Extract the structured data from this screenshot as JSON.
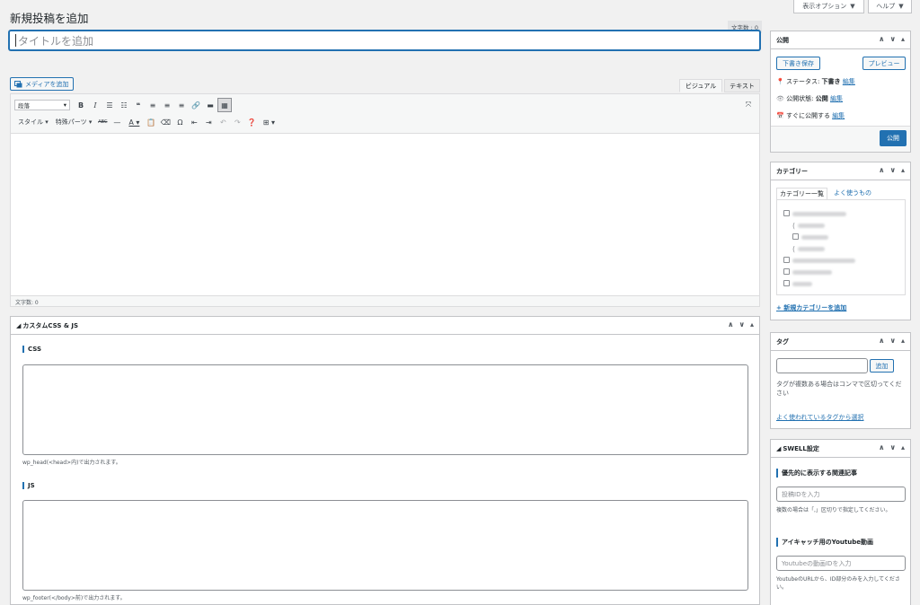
{
  "screen_options": {
    "display_options": "表示オプション",
    "help": "ヘルプ"
  },
  "page_title": "新規投稿を追加",
  "title_field": {
    "wordcount": "文字数 : 0",
    "placeholder": "タイトルを追加"
  },
  "media": {
    "add_media": "メディアを追加"
  },
  "editor": {
    "tab_visual": "ビジュアル",
    "tab_text": "テキスト",
    "format_select": "段落",
    "style_dropdown": "スタイル",
    "special_parts_dropdown": "特殊パーツ",
    "wordcount": "文字数: 0"
  },
  "custom_css_js": {
    "title": "カスタムCSS & JS",
    "css_label": "CSS",
    "css_note": "wp_head(<head>内)で出力されます。",
    "js_label": "JS",
    "js_note": "wp_footer(</body>前)で出力されます。"
  },
  "publish": {
    "title": "公開",
    "save_draft": "下書き保存",
    "preview": "プレビュー",
    "status_label": "ステータス:",
    "status_value": "下書き",
    "visibility_label": "公開状態:",
    "visibility_value": "公開",
    "schedule_label": "すぐに公開する",
    "edit": "編集",
    "publish_button": "公開"
  },
  "categories": {
    "title": "カテゴリー",
    "tab_all": "カテゴリー一覧",
    "tab_popular": "よく使うもの",
    "add_new": "+ 新規カテゴリーを追加"
  },
  "tags": {
    "title": "タグ",
    "add": "追加",
    "hint": "タグが複数ある場合はコンマで区切ってください",
    "choose_popular": "よく使われているタグから選択"
  },
  "swell": {
    "title": "SWELL設定",
    "related_label": "優先的に表示する関連記事",
    "related_placeholder": "投稿IDを入力",
    "related_hint": "複数の場合は「,」区切りで指定してください。",
    "youtube_label": "アイキャッチ用のYoutube動画",
    "youtube_placeholder": "Youtubeの動画IDを入力",
    "youtube_hint": "YoutubeのURLから、ID部分のみを入力してください。"
  },
  "colors": {
    "accent": "#2271b1",
    "background": "#f1f1f1"
  }
}
